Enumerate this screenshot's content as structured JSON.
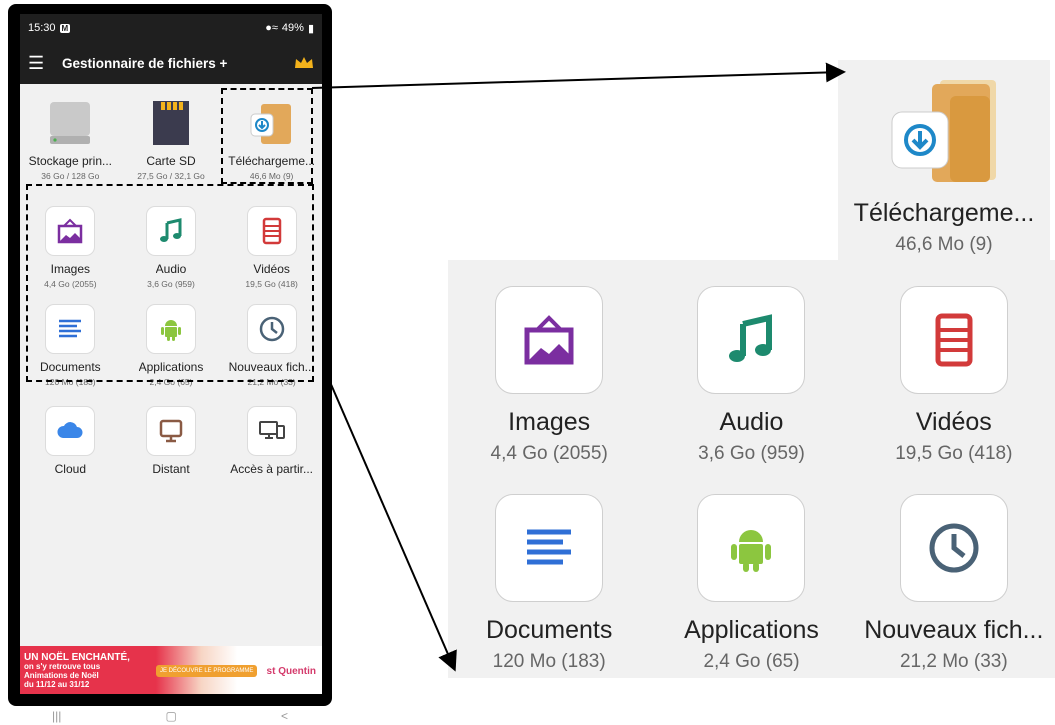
{
  "status": {
    "time": "15:30",
    "battery": "49%"
  },
  "toolbar": {
    "title": "Gestionnaire de fichiers +"
  },
  "storage": [
    {
      "label": "Stockage prin...",
      "size": "36 Go / 128 Go",
      "icon": "hard-drive-icon"
    },
    {
      "label": "Carte SD",
      "size": "27,5 Go / 32,1 Go",
      "icon": "sd-card-icon"
    },
    {
      "label": "Téléchargeme...",
      "size": "46,6 Mo (9)",
      "icon": "download-folder-icon"
    }
  ],
  "categories": [
    {
      "label": "Images",
      "size": "4,4 Go (2055)",
      "icon": "image-icon",
      "color": "#7b2ea0"
    },
    {
      "label": "Audio",
      "size": "3,6 Go (959)",
      "icon": "music-note-icon",
      "color": "#1d8a6e"
    },
    {
      "label": "Vidéos",
      "size": "19,5 Go (418)",
      "icon": "film-icon",
      "color": "#d23a3a"
    },
    {
      "label": "Documents",
      "size": "120 Mo (183)",
      "icon": "document-lines-icon",
      "color": "#2f6fd6"
    },
    {
      "label": "Applications",
      "size": "2,4 Go (65)",
      "icon": "android-icon",
      "color": "#8cc63f"
    },
    {
      "label": "Nouveaux fich...",
      "size": "21,2 Mo (33)",
      "icon": "clock-icon",
      "color": "#4a6276"
    }
  ],
  "network": [
    {
      "label": "Cloud",
      "icon": "cloud-icon",
      "color": "#3a86e8"
    },
    {
      "label": "Distant",
      "icon": "monitor-icon",
      "color": "#8a5a44"
    },
    {
      "label": "Accès à partir...",
      "icon": "devices-icon",
      "color": "#444444"
    }
  ],
  "ad": {
    "headline": "UN NOËL ENCHANTÉ,",
    "line2": "on s'y retrouve tous",
    "line3": "Animations de Noël",
    "line4": "du 11/12 au 31/12",
    "cta": "JE DÉCOUVRE LE PROGRAMME",
    "brand": "st Quentin"
  },
  "zoom": {
    "download": {
      "label": "Téléchargeme...",
      "size": "46,6 Mo (9)"
    },
    "categories": [
      {
        "label": "Images",
        "size": "4,4 Go (2055)"
      },
      {
        "label": "Audio",
        "size": "3,6 Go (959)"
      },
      {
        "label": "Vidéos",
        "size": "19,5 Go (418)"
      },
      {
        "label": "Documents",
        "size": "120 Mo (183)"
      },
      {
        "label": "Applications",
        "size": "2,4 Go (65)"
      },
      {
        "label": "Nouveaux fich...",
        "size": "21,2 Mo (33)"
      }
    ]
  }
}
